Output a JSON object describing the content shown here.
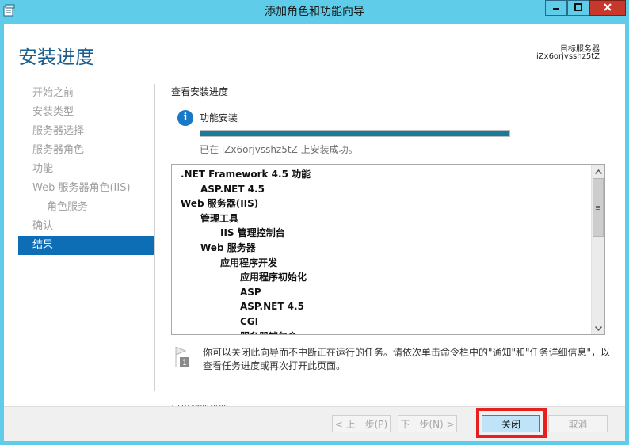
{
  "window": {
    "title": "添加角色和功能向导",
    "icon": "server-manager-icon",
    "controls": [
      "minimize-icon",
      "maximize-icon",
      "close-icon"
    ]
  },
  "header": {
    "page_title": "安装进度",
    "server_label": "目标服务器",
    "server_name": "iZx6orjvsshz5tZ"
  },
  "nav": {
    "items": [
      {
        "label": "开始之前",
        "state": "disabled"
      },
      {
        "label": "安装类型",
        "state": "disabled"
      },
      {
        "label": "服务器选择",
        "state": "disabled"
      },
      {
        "label": "服务器角色",
        "state": "disabled"
      },
      {
        "label": "功能",
        "state": "disabled"
      },
      {
        "label": "Web 服务器角色(IIS)",
        "state": "disabled"
      },
      {
        "label": "角色服务",
        "state": "disabled"
      },
      {
        "label": "确认",
        "state": "disabled"
      },
      {
        "label": "结果",
        "state": "active"
      }
    ]
  },
  "content": {
    "section_title": "查看安装进度",
    "feature_label": "功能安装",
    "progress": 1.0,
    "status_text": "已在 iZx6orjvsshz5tZ 上安装成功。",
    "tree": [
      {
        "label": ".NET Framework 4.5 功能",
        "level": 0
      },
      {
        "label": "ASP.NET 4.5",
        "level": 1
      },
      {
        "label": "Web 服务器(IIS)",
        "level": 0
      },
      {
        "label": "管理工具",
        "level": 1
      },
      {
        "label": "IIS 管理控制台",
        "level": 2
      },
      {
        "label": "Web 服务器",
        "level": 1
      },
      {
        "label": "应用程序开发",
        "level": 2
      },
      {
        "label": "应用程序初始化",
        "level": 3
      },
      {
        "label": "ASP",
        "level": 3
      },
      {
        "label": "ASP.NET 4.5",
        "level": 3
      },
      {
        "label": "CGI",
        "level": 3
      },
      {
        "label": "服务器端包含",
        "level": 3
      }
    ],
    "note_text": "你可以关闭此向导而不中断正在运行的任务。请依次单击命令栏中的\"通知\"和\"任务详细信息\"，以查看任务进度或再次打开此页面。",
    "note_badge": "1",
    "export_link": "导出配置设置"
  },
  "footer": {
    "prev_label": "< 上一步(P)",
    "next_label": "下一步(N) >",
    "close_label": "关闭",
    "cancel_label": "取消"
  },
  "colors": {
    "titlebar": "#5fcdea",
    "accent": "#0d6eb6",
    "progress": "#1a7a9a",
    "highlight": "#e5201f"
  }
}
